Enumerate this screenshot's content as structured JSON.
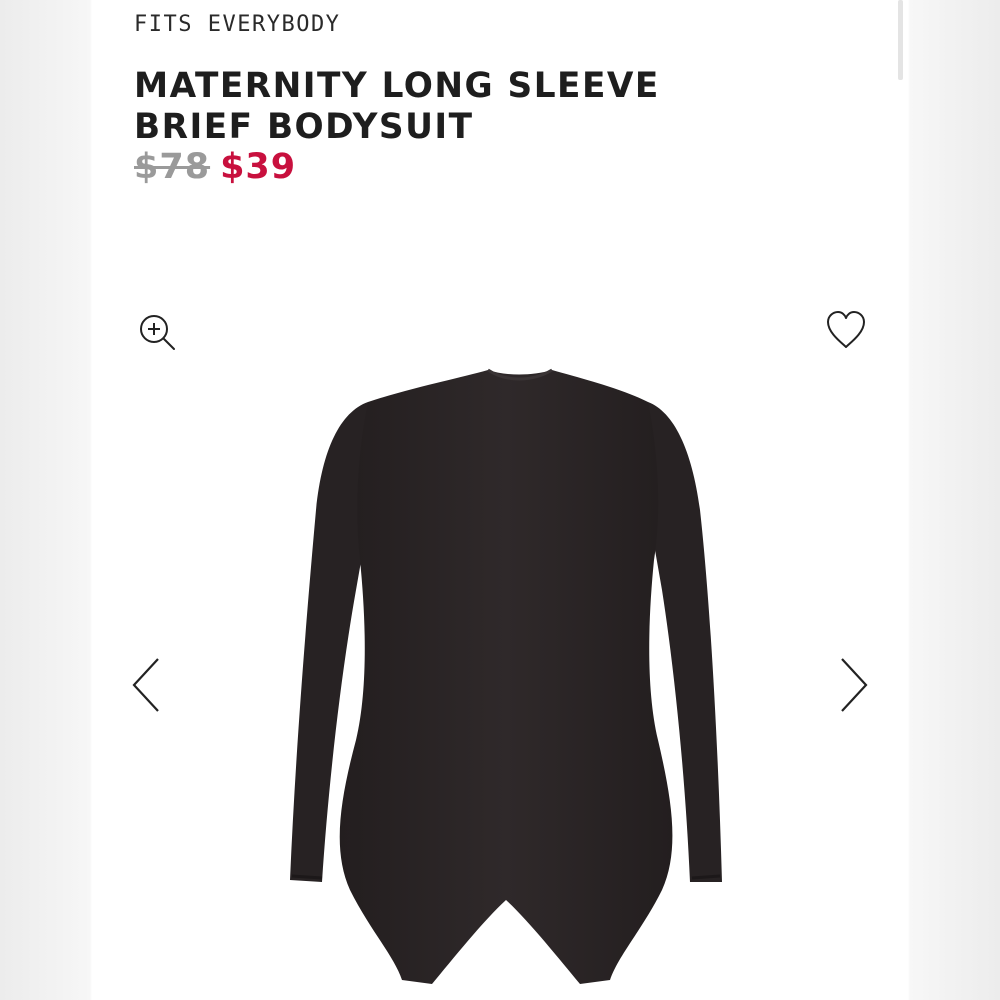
{
  "product": {
    "collection": "FITS EVERYBODY",
    "title": "MATERNITY LONG SLEEVE BRIEF BODYSUIT",
    "original_price": "$78",
    "sale_price": "$39"
  },
  "icons": {
    "zoom": "zoom-in-icon",
    "favorite": "heart-outline-icon",
    "previous": "chevron-left-icon",
    "next": "chevron-right-icon"
  },
  "colors": {
    "text": "#1e1e1e",
    "original_price": "#9a9a9a",
    "sale_price": "#c8103e",
    "garment": "#2b2627"
  }
}
